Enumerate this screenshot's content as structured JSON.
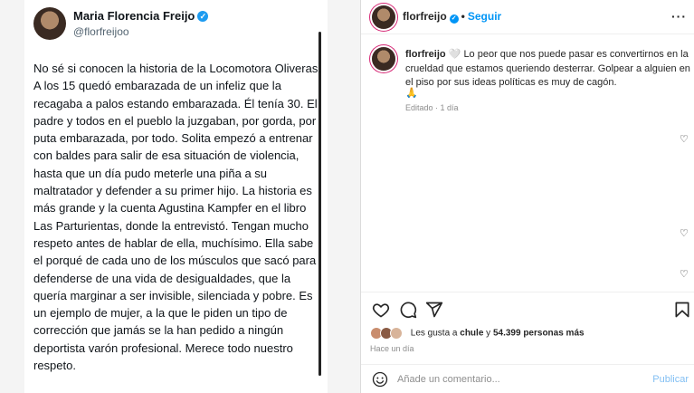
{
  "tweet": {
    "name": "Maria Florencia Freijo",
    "handle": "@florfreijoo",
    "text": "No sé si conocen la historia de la Locomotora Oliveras. A los 15 quedó embarazada de un infeliz que la recagaba a palos estando embarazada. Él tenía 30. El padre y todos en el pueblo la juzgaban, por gorda, por puta embarazada, por todo. Solita empezó a entrenar con baldes para salir de esa situación de violencia, hasta que un día pudo meterle una piña a su maltratador y defender a su primer hijo. La historia es más grande y la cuenta Agustina Kampfer en el libro Las Parturientas, donde la entrevistó. Tengan mucho respeto antes de hablar de ella, muchísimo. Ella sabe el porqué de cada uno de los músculos que sacó para defenderse de una vida de desigualdades, que la quería marginar a ser invisible, silenciada y pobre. Es un ejemplo de mujer, a la que le piden un tipo de corrección que jamás se la han pedido a ningún deportista varón profesional. Merece todo nuestro respeto."
  },
  "post": {
    "username": "florfreijo",
    "dot": "•",
    "follow_label": "Seguir",
    "more_label": "···",
    "caption_user": "florfreijo",
    "caption_text": "🤍 Lo peor que nos puede pasar es convertirnos en la crueldad que estamos queriendo desterrar. Golpear a alguien en el piso por sus ideas políticas es muy de cagón.",
    "caption_emoji": "🙏",
    "meta": "Editado · 1 día",
    "likes_prefix": "Les gusta a ",
    "likes_user": "chule",
    "likes_mid": " y ",
    "likes_count": "54.399 personas más",
    "time_ago": "Hace un día",
    "comment_placeholder": "Añade un comentario...",
    "publish_label": "Publicar",
    "small_heart": "♡"
  },
  "colors": {
    "accent": "#0095f6",
    "twitter_blue": "#1d9bf0",
    "publish_disabled": "#82bff3"
  }
}
